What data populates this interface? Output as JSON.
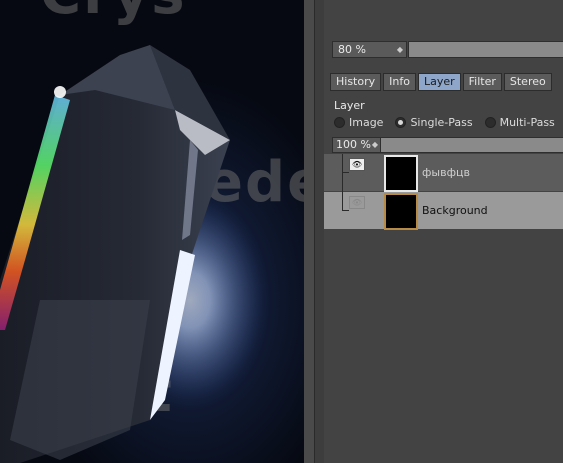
{
  "viewport": {
    "bg_text_top": "Crys",
    "bg_text_mid": "ede",
    "bg_text_low": "t"
  },
  "panel": {
    "zoom": "80 %",
    "tabs": [
      {
        "label": "History",
        "active": false
      },
      {
        "label": "Info",
        "active": false
      },
      {
        "label": "Layer",
        "active": true
      },
      {
        "label": "Filter",
        "active": false
      },
      {
        "label": "Stereo",
        "active": false
      }
    ],
    "layer_header": "Layer",
    "modes": [
      "Image",
      "Single-Pass",
      "Multi-Pass"
    ],
    "selected_mode": "Single-Pass",
    "opacity": "100 %",
    "layers": [
      {
        "name": "фывфцв",
        "visible": true
      },
      {
        "name": "Background",
        "visible": false
      }
    ]
  },
  "colors": {
    "panel_bg": "#434343",
    "active_tab": "#8ea6c9",
    "selected_row": "#9a9a9a",
    "thumb_border_selected": "#b78b45"
  },
  "icons": {
    "eye": "eye-icon",
    "stepper": "stepper-arrows-icon"
  }
}
